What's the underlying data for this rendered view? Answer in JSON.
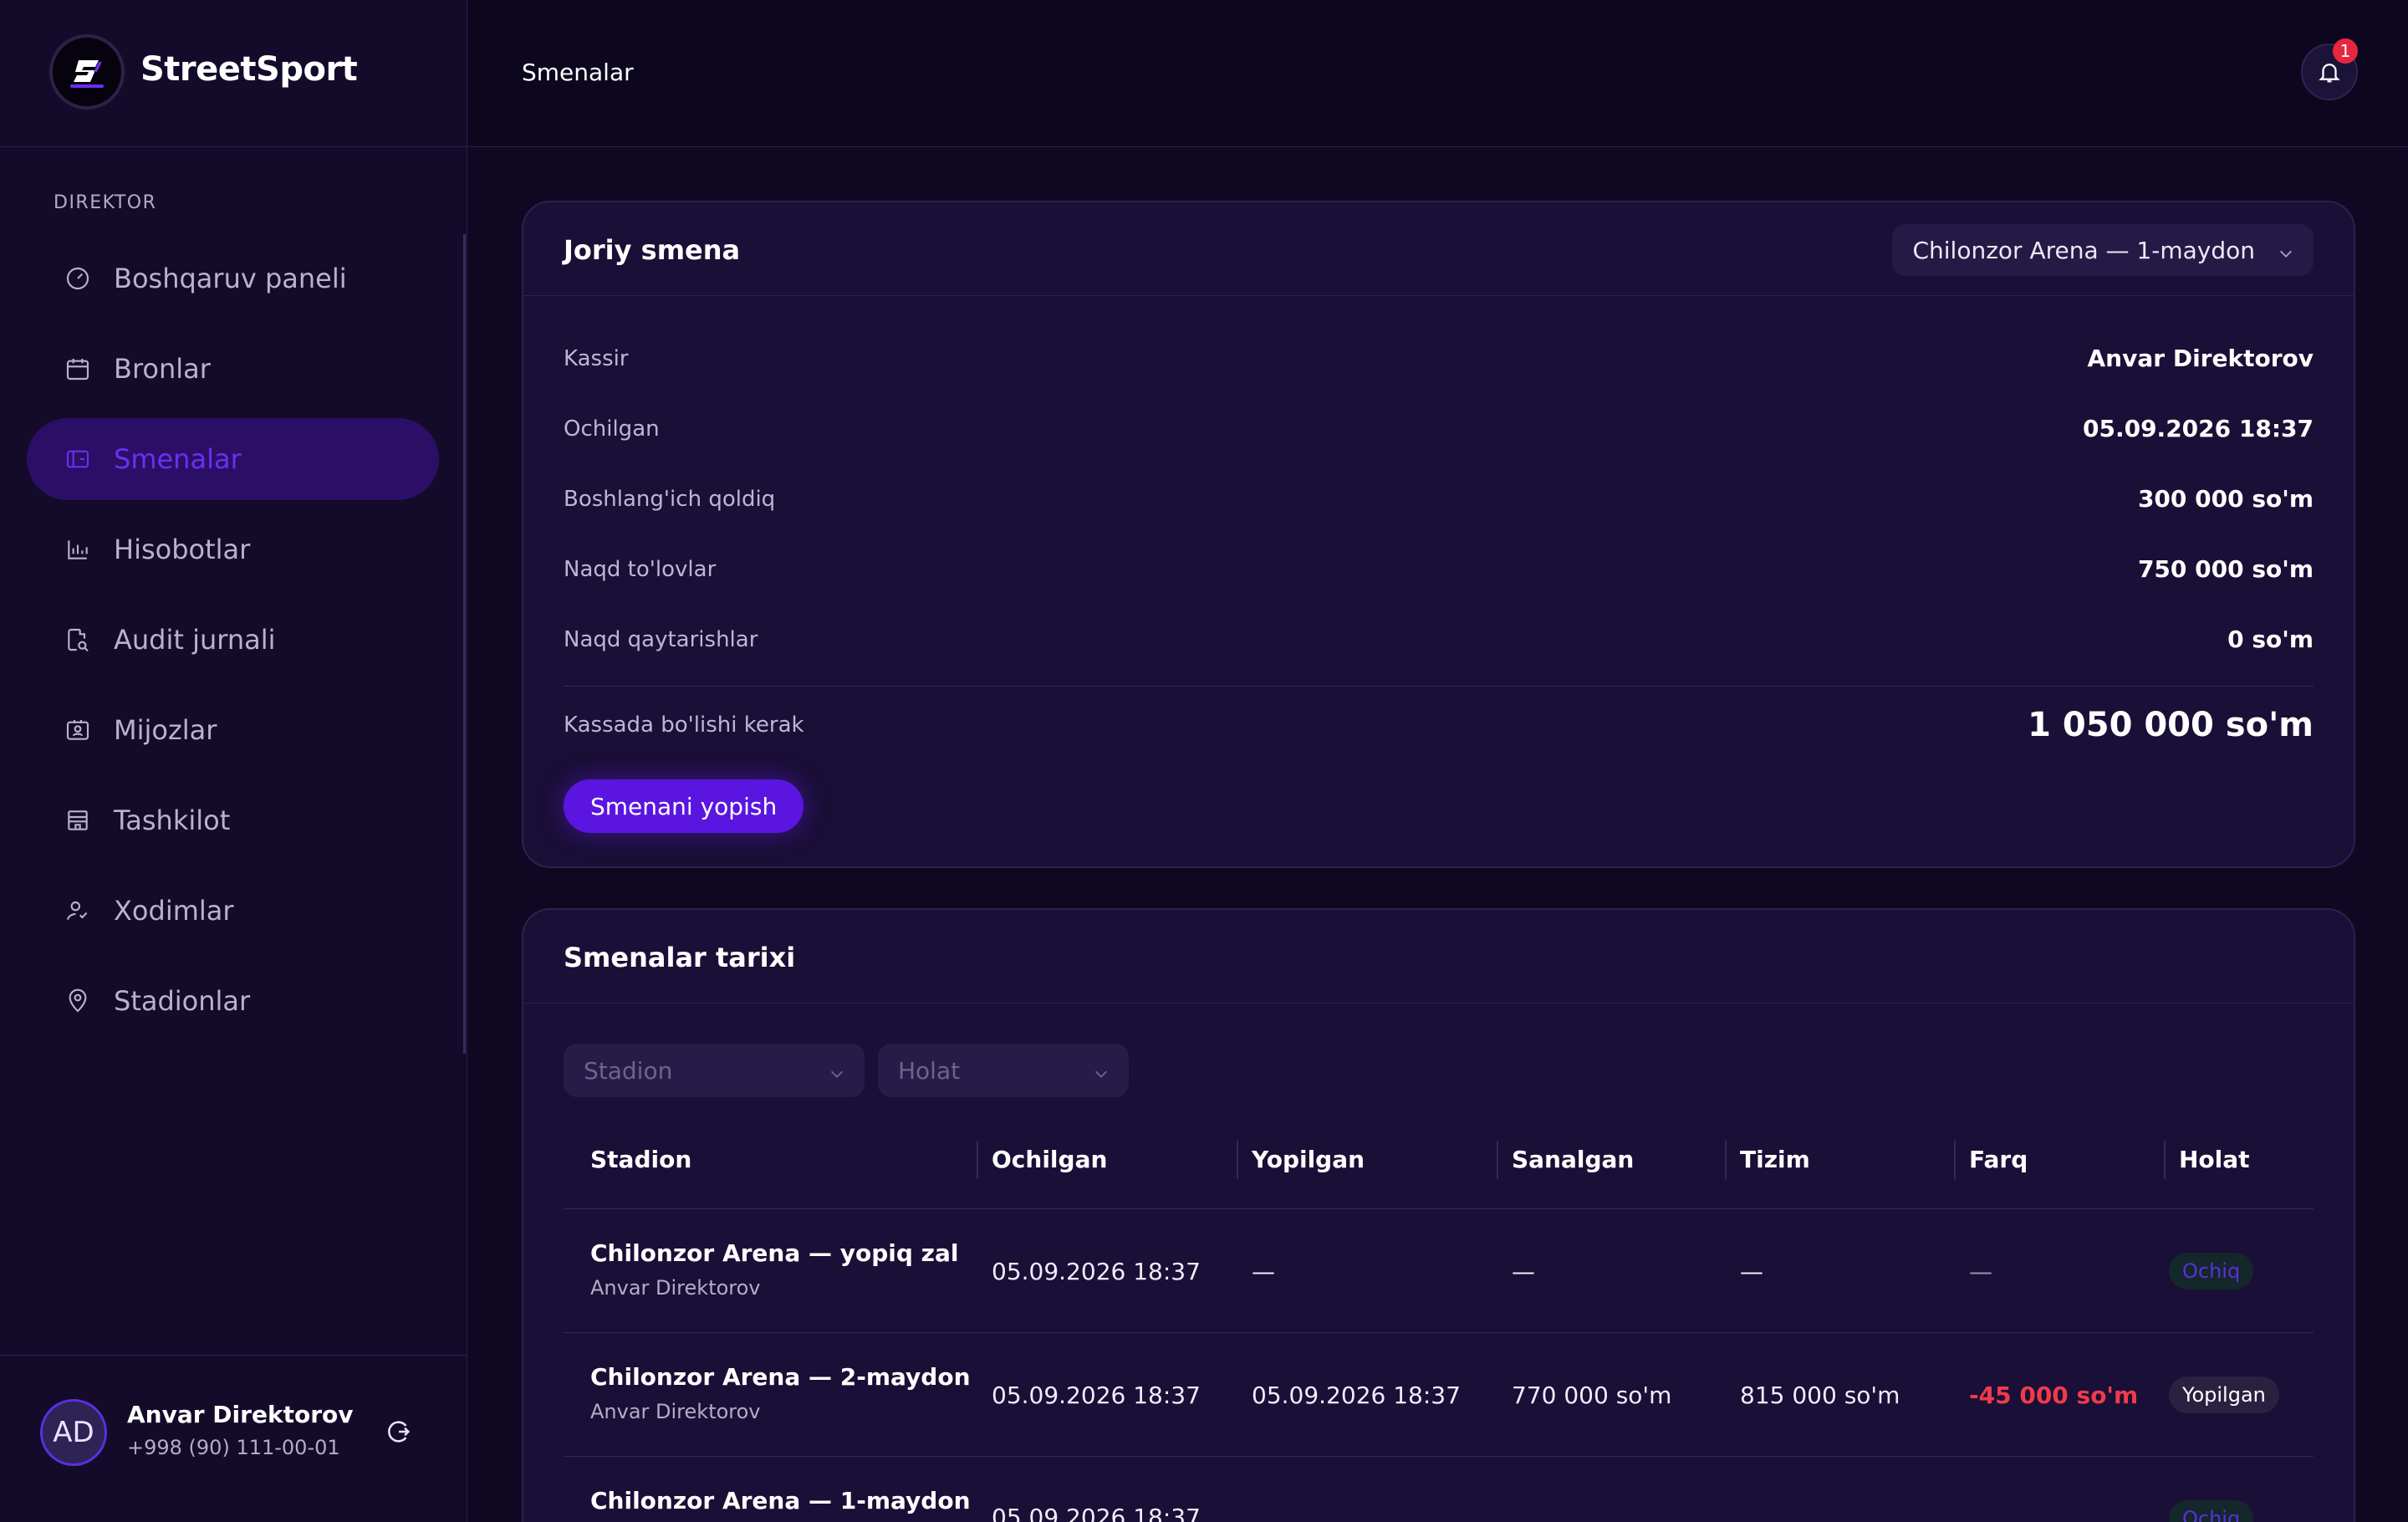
{
  "brand": {
    "name": "StreetSport",
    "logo_text": "STREETSPORT"
  },
  "sidebar": {
    "section_label": "DIREKTOR",
    "items": [
      {
        "label": "Boshqaruv paneli",
        "icon": "gauge-icon"
      },
      {
        "label": "Bronlar",
        "icon": "calendar-icon"
      },
      {
        "label": "Smenalar",
        "icon": "wallet-icon",
        "active": true
      },
      {
        "label": "Hisobotlar",
        "icon": "bar-chart-icon"
      },
      {
        "label": "Audit jurnali",
        "icon": "audit-log-icon"
      },
      {
        "label": "Mijozlar",
        "icon": "contact-card-icon"
      },
      {
        "label": "Tashkilot",
        "icon": "store-icon"
      },
      {
        "label": "Xodimlar",
        "icon": "staff-icon"
      },
      {
        "label": "Stadionlar",
        "icon": "map-pin-icon"
      }
    ]
  },
  "user": {
    "initials": "AD",
    "name": "Anvar Direktorov",
    "phone": "+998 (90) 111-00-01"
  },
  "header": {
    "title": "Smenalar",
    "notifications_count": "1"
  },
  "current_shift": {
    "title": "Joriy smena",
    "stadium_select": "Chilonzor Arena — 1-maydon",
    "rows": [
      {
        "label": "Kassir",
        "value": "Anvar Direktorov"
      },
      {
        "label": "Ochilgan",
        "value": "05.09.2026 18:37"
      },
      {
        "label": "Boshlang'ich qoldiq",
        "value": "300 000 so'm"
      },
      {
        "label": "Naqd to'lovlar",
        "value": "750 000 so'm"
      },
      {
        "label": "Naqd qaytarishlar",
        "value": "0 so'm"
      }
    ],
    "total_label": "Kassada bo'lishi kerak",
    "total_value": "1 050 000 so'm",
    "close_button": "Smenani yopish"
  },
  "history": {
    "title": "Smenalar tarixi",
    "filters": {
      "stadium_placeholder": "Stadion",
      "status_placeholder": "Holat"
    },
    "columns": [
      "Stadion",
      "Ochilgan",
      "Yopilgan",
      "Sanalgan",
      "Tizim",
      "Farq",
      "Holat"
    ],
    "rows": [
      {
        "stadium": "Chilonzor Arena — yopiq zal",
        "cashier": "Anvar Direktorov",
        "opened": "05.09.2026 18:37",
        "closed": "—",
        "counted": "—",
        "system": "—",
        "diff": "—",
        "status": "Ochiq"
      },
      {
        "stadium": "Chilonzor Arena — 2-maydon",
        "cashier": "Anvar Direktorov",
        "opened": "05.09.2026 18:37",
        "closed": "05.09.2026 18:37",
        "counted": "770 000 so'm",
        "system": "815 000 so'm",
        "diff": "-45 000 so'm",
        "status": "Yopilgan"
      },
      {
        "stadium": "Chilonzor Arena — 1-maydon",
        "cashier": "",
        "opened": "05.09.2026 18:37",
        "closed": "",
        "counted": "",
        "system": "",
        "diff": "",
        "status": "Ochiq"
      }
    ]
  },
  "colors": {
    "accent": "#5a16e0",
    "active_text": "#6a2ff0",
    "negative": "#ef3b4c",
    "background": "#100822",
    "card": "#1a0f36"
  }
}
